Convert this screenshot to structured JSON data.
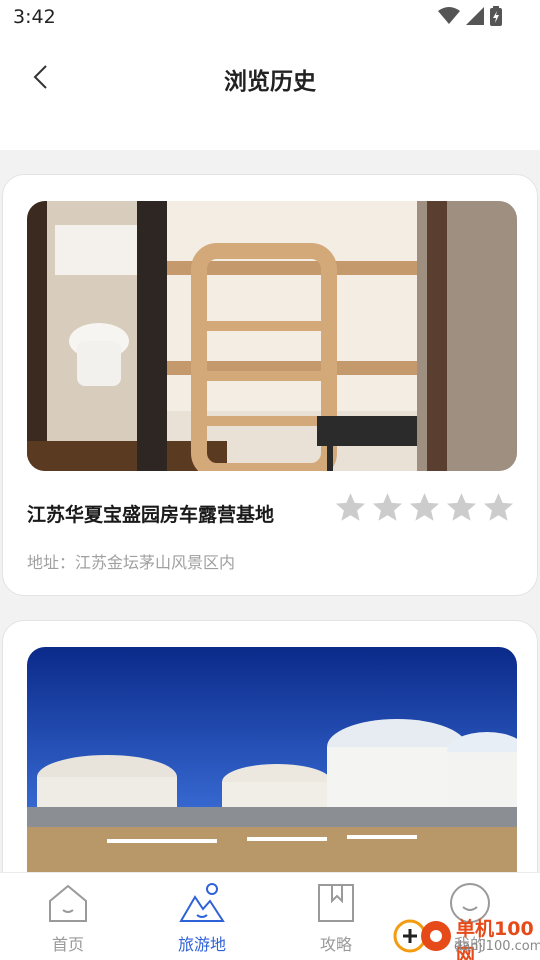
{
  "status": {
    "time": "3:42",
    "tag": "97f0e1"
  },
  "header": {
    "title": "浏览历史"
  },
  "cards": [
    {
      "name": "江苏华夏宝盛园房车露营基地",
      "address": "地址：江苏金坛茅山风景区内",
      "rating_stars": 0,
      "max_stars": 5
    },
    {
      "name": "",
      "address": ""
    }
  ],
  "nav": {
    "items": [
      {
        "label": "首页",
        "icon": "home-icon",
        "active": false
      },
      {
        "label": "旅游地",
        "icon": "mountain-icon",
        "active": true
      },
      {
        "label": "攻略",
        "icon": "bookmark-icon",
        "active": false
      },
      {
        "label": "我的",
        "icon": "smile-icon",
        "active": false
      }
    ]
  },
  "watermark": {
    "brand": "单机100网",
    "url": "danji100.com"
  },
  "colors": {
    "accent": "#2f62d8",
    "star_inactive": "#cccccc",
    "text_muted": "#a0a0a0"
  }
}
